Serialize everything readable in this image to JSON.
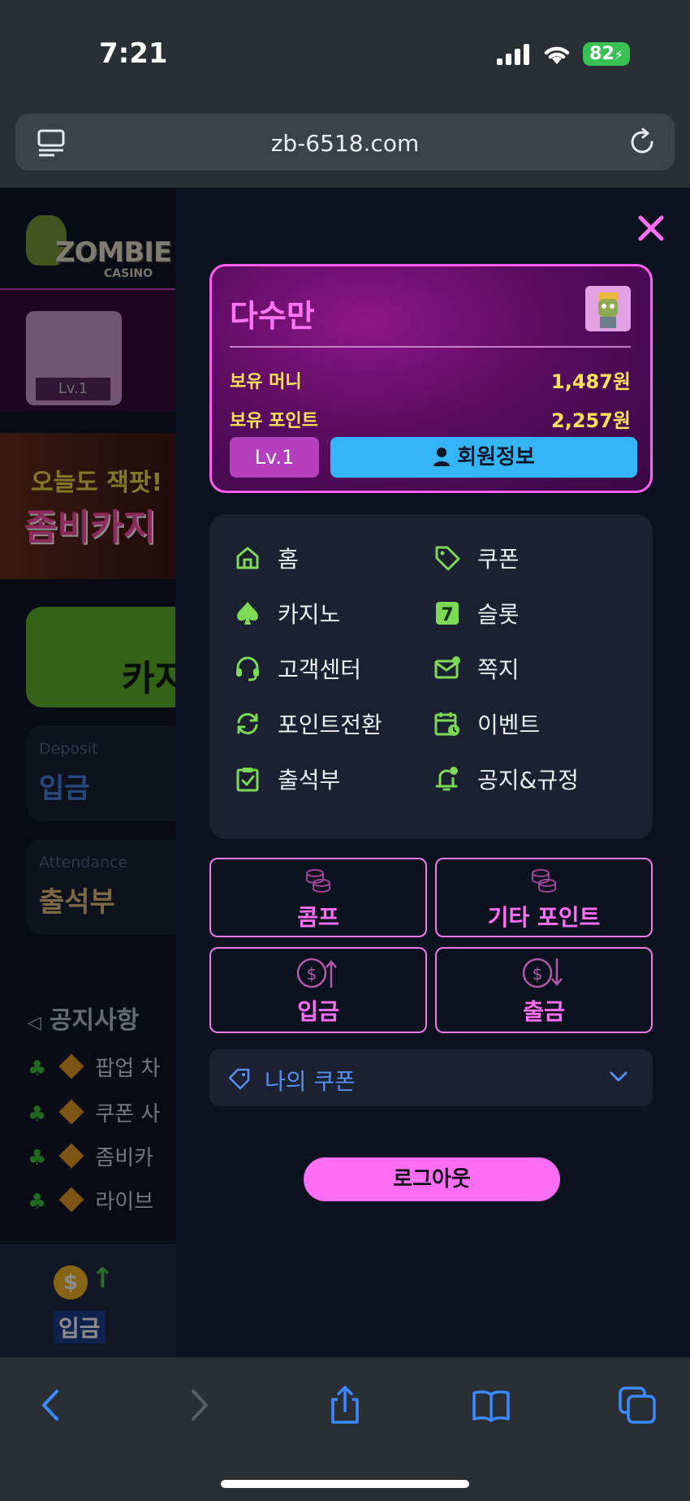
{
  "status_bar": {
    "time": "7:21",
    "battery": "82"
  },
  "browser": {
    "url": "zb-6518.com"
  },
  "background_page": {
    "logo_text": "ZOMBIE",
    "logo_sub": "CASINO",
    "avatar_level": "Lv.1",
    "banner_line1": "오늘도 잭팟!",
    "banner_line2": "좀비카지",
    "green_card_text": "카지",
    "deposit_card": {
      "en": "Deposit",
      "ko": "입금"
    },
    "attendance_card": {
      "en": "Attendance",
      "ko": "출석부"
    },
    "notice_title": "공지사항",
    "notices": [
      "팝업 차",
      "쿠폰 사",
      "좀비카",
      "라이브"
    ],
    "bottom_button_label": "입금"
  },
  "drawer": {
    "username": "다수만",
    "money_label": "보유 머니",
    "money_value": "1,487원",
    "points_label": "보유 포인트",
    "points_value": "2,257원",
    "level": "Lv.1",
    "member_info_label": "회원정보",
    "menu_left": [
      {
        "label": "홈",
        "icon": "home-icon"
      },
      {
        "label": "카지노",
        "icon": "spade-icon"
      },
      {
        "label": "고객센터",
        "icon": "headset-icon"
      },
      {
        "label": "포인트전환",
        "icon": "refresh-icon"
      },
      {
        "label": "출석부",
        "icon": "clipboard-check-icon"
      }
    ],
    "menu_right": [
      {
        "label": "쿠폰",
        "icon": "tag-icon"
      },
      {
        "label": "슬롯",
        "icon": "seven-icon"
      },
      {
        "label": "쪽지",
        "icon": "mail-icon"
      },
      {
        "label": "이벤트",
        "icon": "calendar-clock-icon"
      },
      {
        "label": "공지&규정",
        "icon": "bell-icon"
      }
    ],
    "buttons": {
      "comp": "콤프",
      "other_points": "기타 포인트",
      "deposit": "입금",
      "withdraw": "출금"
    },
    "my_coupon": "나의 쿠폰",
    "logout": "로그아웃"
  },
  "colors": {
    "accent_pink": "#ff6ef4",
    "accent_green": "#7ed957",
    "accent_blue": "#35b5f5",
    "accent_yellow": "#ffe25a"
  }
}
